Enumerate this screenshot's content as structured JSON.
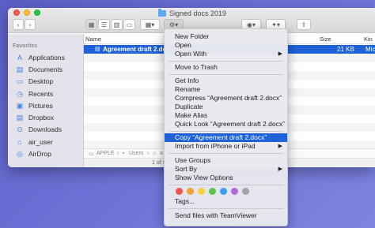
{
  "window": {
    "title": "Signed docs 2019"
  },
  "toolbar": {
    "back_label": "‹",
    "forward_label": "›",
    "view_icons": [
      "▦",
      "☰",
      "▥",
      "▭"
    ],
    "group_label": "▦▾",
    "action_label": "⚙▾",
    "share_label": "⇪",
    "tag_label": "⬭",
    "web_label": "◉▾",
    "dropbox_label": "✦▾"
  },
  "sidebar": {
    "heading": "Favorites",
    "items": [
      {
        "label": "Applications",
        "icon": "applications-icon",
        "glyph": "A"
      },
      {
        "label": "Documents",
        "icon": "documents-icon",
        "glyph": "▤"
      },
      {
        "label": "Desktop",
        "icon": "desktop-icon",
        "glyph": "▭"
      },
      {
        "label": "Recents",
        "icon": "recents-icon",
        "glyph": "◷"
      },
      {
        "label": "Pictures",
        "icon": "pictures-icon",
        "glyph": "▣"
      },
      {
        "label": "Dropbox",
        "icon": "dropbox-icon",
        "glyph": "▤"
      },
      {
        "label": "Downloads",
        "icon": "downloads-icon",
        "glyph": "⊙"
      },
      {
        "label": "air_user",
        "icon": "home-icon",
        "glyph": "⌂"
      },
      {
        "label": "AirDrop",
        "icon": "airdrop-icon",
        "glyph": "◎"
      }
    ]
  },
  "list": {
    "columns": {
      "name": "Name",
      "size": "Size",
      "kind": "Kin"
    },
    "selected_file": {
      "name": "Agreement draft 2.docx",
      "size": "21 KB",
      "kind": "Mic"
    }
  },
  "path_bar": {
    "segments": [
      "APPLE",
      "Users",
      "a"
    ]
  },
  "status_bar": {
    "text": "1 of s"
  },
  "context_menu": {
    "items": [
      {
        "label": "New Folder",
        "type": "item"
      },
      {
        "label": "Open",
        "type": "item"
      },
      {
        "label": "Open With",
        "type": "submenu"
      },
      {
        "type": "separator"
      },
      {
        "label": "Move to Trash",
        "type": "item"
      },
      {
        "type": "separator"
      },
      {
        "label": "Get Info",
        "type": "item"
      },
      {
        "label": "Rename",
        "type": "item"
      },
      {
        "label": "Compress “Agreement draft 2.docx”",
        "type": "item"
      },
      {
        "label": "Duplicate",
        "type": "item"
      },
      {
        "label": "Make Alias",
        "type": "item"
      },
      {
        "label": "Quick Look “Agreement draft 2.docx”",
        "type": "item"
      },
      {
        "type": "separator"
      },
      {
        "label": "Copy “Agreement draft 2.docx”",
        "type": "item",
        "highlighted": true
      },
      {
        "label": "Import from iPhone or iPad",
        "type": "submenu"
      },
      {
        "type": "separator"
      },
      {
        "label": "Use Groups",
        "type": "item"
      },
      {
        "label": "Sort By",
        "type": "submenu"
      },
      {
        "label": "Show View Options",
        "type": "item"
      },
      {
        "type": "separator"
      },
      {
        "type": "tags"
      },
      {
        "label": "Tags...",
        "type": "item"
      },
      {
        "type": "separator"
      },
      {
        "label": "Send files with TeamViewer",
        "type": "item"
      }
    ],
    "submenu_arrow": "▶",
    "tag_colors": [
      "#f0524f",
      "#f6a035",
      "#f5d13b",
      "#5cc64b",
      "#3c9bf5",
      "#b26ad9",
      "#a4a4a8"
    ]
  }
}
